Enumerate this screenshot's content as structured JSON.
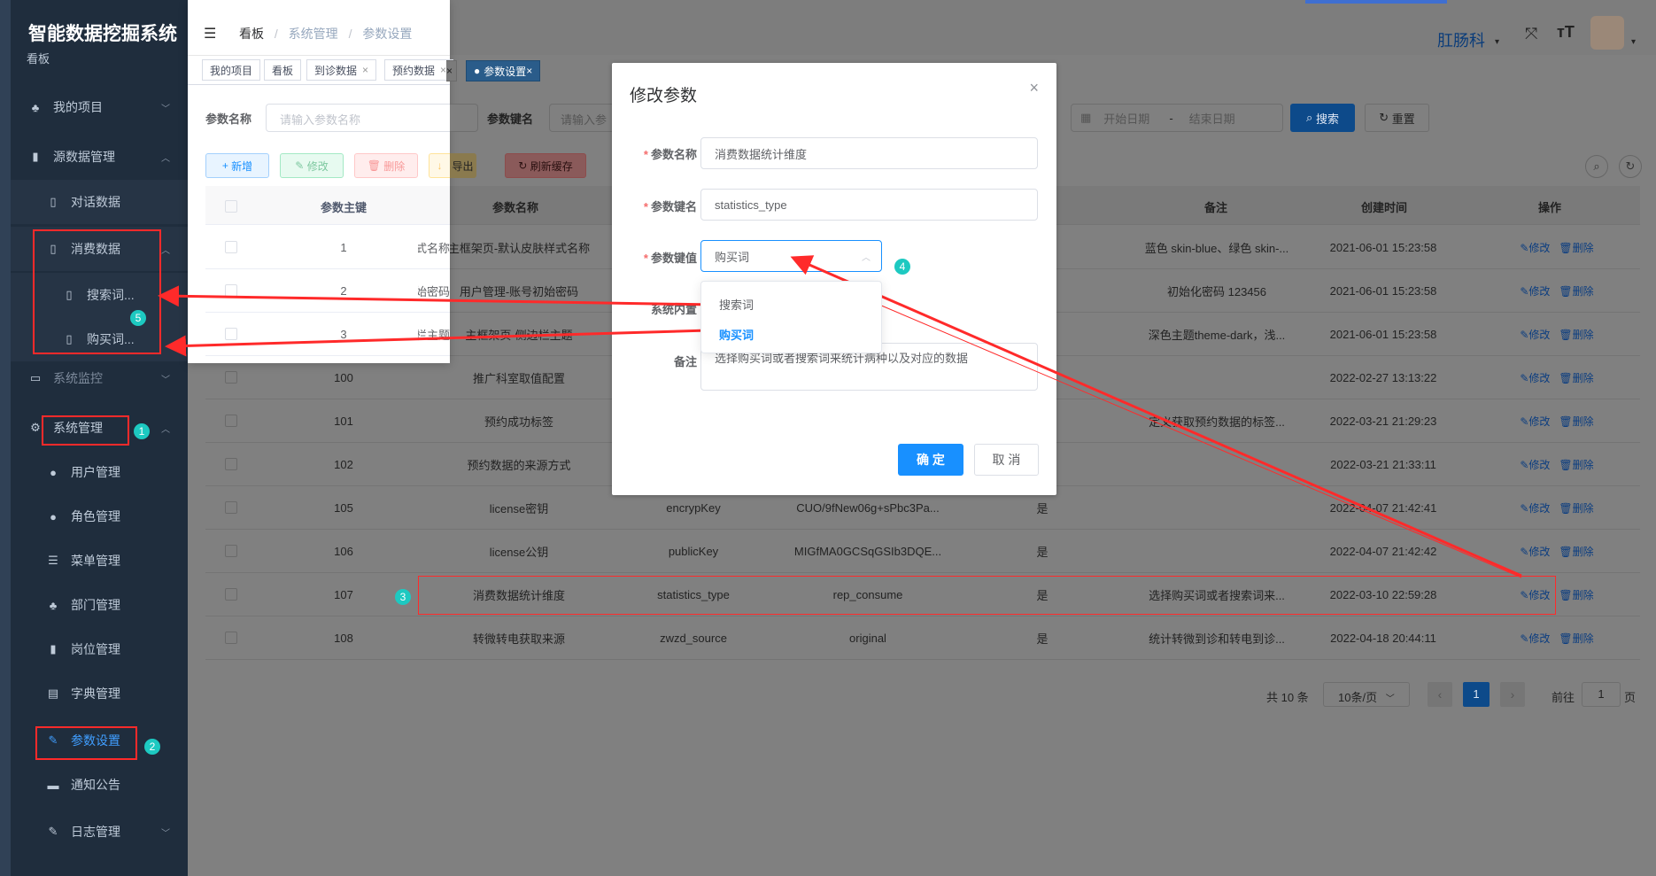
{
  "sidebar": {
    "title": "智能数据挖掘系统",
    "subtitle": "看板",
    "items": [
      {
        "label": "我的项目",
        "icon": "sitemap-icon"
      },
      {
        "label": "源数据管理",
        "icon": "bar-chart-icon"
      },
      {
        "label": "对话数据",
        "icon": "book-icon"
      },
      {
        "label": "消费数据",
        "icon": "book-icon"
      },
      {
        "label": "搜索词...",
        "icon": "book-icon"
      },
      {
        "label": "购买词...",
        "icon": "book-icon"
      },
      {
        "label": "系统监控",
        "icon": "monitor-icon"
      },
      {
        "label": "系统管理",
        "icon": "gear-icon"
      },
      {
        "label": "用户管理",
        "icon": "user-icon"
      },
      {
        "label": "角色管理",
        "icon": "peoples-icon"
      },
      {
        "label": "菜单管理",
        "icon": "tree-table-icon"
      },
      {
        "label": "部门管理",
        "icon": "tree-icon"
      },
      {
        "label": "岗位管理",
        "icon": "post-icon"
      },
      {
        "label": "字典管理",
        "icon": "dict-icon"
      },
      {
        "label": "参数设置",
        "icon": "edit-icon"
      },
      {
        "label": "通知公告",
        "icon": "message-icon"
      },
      {
        "label": "日志管理",
        "icon": "log-icon"
      }
    ]
  },
  "header": {
    "breadcrumb": [
      "看板",
      "系统管理",
      "参数设置"
    ],
    "user": "肛肠科"
  },
  "tags": [
    "我的项目",
    "看板",
    "到诊数据",
    "预约数据",
    "参数设置"
  ],
  "search": {
    "name_label": "参数名称",
    "name_placeholder": "请输入参数名称",
    "key_label": "参数键名",
    "key_placeholder": "请输入参",
    "date_start": "开始日期",
    "date_sep": "-",
    "date_end": "结束日期",
    "search_btn": "搜索",
    "reset_btn": "重置"
  },
  "toolbar": {
    "add": "新增",
    "edit": "修改",
    "delete": "删除",
    "export": "导出",
    "refresh": "刷新缓存"
  },
  "table": {
    "headers": {
      "id": "参数主键",
      "name": "参数名称",
      "builtin": "置",
      "remark": "备注",
      "created": "创建时间",
      "ops": "操作"
    },
    "edit_label": "修改",
    "delete_label": "删除",
    "rows": [
      {
        "id": "1",
        "name": "主框架页-默认皮肤样式名称",
        "key": "",
        "value": "",
        "builtin": "",
        "remark": "蓝色 skin-blue、绿色 skin-...",
        "created": "2021-06-01 15:23:58"
      },
      {
        "id": "2",
        "name": "用户管理-账号初始密码",
        "key": "",
        "value": "",
        "builtin": "",
        "remark": "初始化密码 123456",
        "created": "2021-06-01 15:23:58"
      },
      {
        "id": "3",
        "name": "主框架页-侧边栏主题",
        "key": "",
        "value": "",
        "builtin": "",
        "remark": "深色主题theme-dark，浅...",
        "created": "2021-06-01 15:23:58"
      },
      {
        "id": "100",
        "name": "推广科室取值配置",
        "key": "",
        "value": "",
        "builtin": "",
        "remark": "",
        "created": "2022-02-27 13:13:22"
      },
      {
        "id": "101",
        "name": "预约成功标签",
        "key": "",
        "value": "",
        "builtin": "",
        "remark": "定义获取预约数据的标签...",
        "created": "2022-03-21 21:29:23"
      },
      {
        "id": "102",
        "name": "预约数据的来源方式",
        "key": "",
        "value": "",
        "builtin": "",
        "remark": "",
        "created": "2022-03-21 21:33:11"
      },
      {
        "id": "105",
        "name": "license密钥",
        "key": "encrypKey",
        "value": "CUO/9fNew06g+sPbc3Pa...",
        "builtin": "是",
        "remark": "",
        "created": "2022-04-07 21:42:41"
      },
      {
        "id": "106",
        "name": "license公钥",
        "key": "publicKey",
        "value": "MIGfMA0GCSqGSIb3DQE...",
        "builtin": "是",
        "remark": "",
        "created": "2022-04-07 21:42:42"
      },
      {
        "id": "107",
        "name": "消费数据统计维度",
        "key": "statistics_type",
        "value": "rep_consume",
        "builtin": "是",
        "remark": "选择购买词或者搜索词来...",
        "created": "2022-03-10 22:59:28"
      },
      {
        "id": "108",
        "name": "转微转电获取来源",
        "key": "zwzd_source",
        "value": "original",
        "builtin": "是",
        "remark": "统计转微到诊和转电到诊...",
        "created": "2022-04-18 20:44:11"
      }
    ]
  },
  "pagination": {
    "total": "共 10 条",
    "size": "10条/页",
    "current": "1",
    "goto": "前往",
    "goto_value": "1",
    "page_unit": "页"
  },
  "dialog": {
    "title": "修改参数",
    "name_label": "参数名称",
    "name_value": "消费数据统计维度",
    "key_label": "参数键名",
    "key_value": "statistics_type",
    "value_label": "参数键值",
    "value_value": "购买词",
    "options": [
      "搜索词",
      "购买词"
    ],
    "builtin_label": "系统内置",
    "remark_label": "备注",
    "remark_value": "选择购买词或者搜索词来统计病种以及对应的数据",
    "ok": "确 定",
    "cancel": "取 消"
  },
  "badges": [
    "1",
    "2",
    "3",
    "4",
    "5"
  ],
  "colors": {
    "primary": "#1890ff",
    "annotation": "#ff2a2a",
    "badge": "#1dc9c1"
  }
}
